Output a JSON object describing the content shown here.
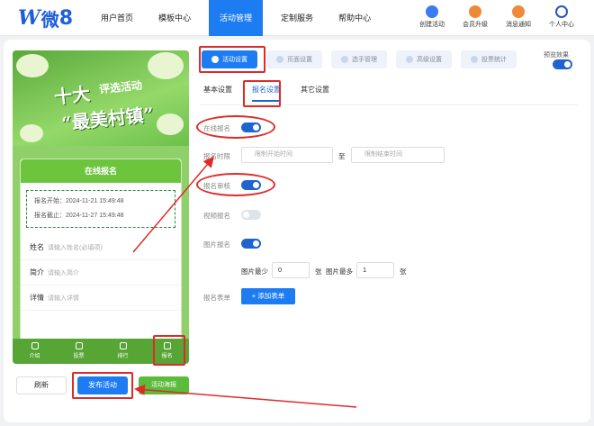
{
  "logo": {
    "w": "W",
    "wei": "微",
    "eight": "8"
  },
  "nav": [
    {
      "label": "用户首页"
    },
    {
      "label": "模板中心"
    },
    {
      "label": "活动管理"
    },
    {
      "label": "定制服务"
    },
    {
      "label": "帮助中心"
    }
  ],
  "tools": [
    {
      "label": "创建活动",
      "color": "#3a7cf0"
    },
    {
      "label": "会员升级",
      "color": "#f0883a"
    },
    {
      "label": "消息通知",
      "color": "#f0883a"
    },
    {
      "label": "个人中心",
      "color": "#2a55c0"
    }
  ],
  "phone": {
    "title_big1": "十大",
    "title_small": "评选活动",
    "title_big2": "“最美村镇”",
    "card_title": "在线报名",
    "start": "报名开始：2024-11-21 15:49:48",
    "end": "报名截止：2024-11-27 15:49:48",
    "fields": [
      {
        "label": "姓名",
        "ph": "请输入姓名(必填项)"
      },
      {
        "label": "简介",
        "ph": "请输入简介"
      },
      {
        "label": "详情",
        "ph": "请输入详情"
      }
    ],
    "tabs": [
      {
        "label": "介绍"
      },
      {
        "label": "投票"
      },
      {
        "label": "排行"
      },
      {
        "label": "报名"
      }
    ]
  },
  "buttons": {
    "refresh": "刷新",
    "publish": "发布活动",
    "poster": "活动海报"
  },
  "sub_tabs": [
    {
      "label": "活动设置"
    },
    {
      "label": "页面设置"
    },
    {
      "label": "选手管理"
    },
    {
      "label": "高级设置"
    },
    {
      "label": "投票统计"
    }
  ],
  "preview_label": "预览效果",
  "inner_tabs": [
    {
      "label": "基本设置"
    },
    {
      "label": "报名设置"
    },
    {
      "label": "其它设置"
    }
  ],
  "form": {
    "online": "在线报名",
    "time": "报名时限",
    "start_ph": "限制开始时间",
    "to": "至",
    "end_ph": "限制结束时间",
    "review": "报名审核",
    "video": "视频报名",
    "image": "图片报名",
    "min_label": "图片最少",
    "min_val": "0",
    "unit1": "张",
    "max_label": "图片最多",
    "max_val": "1",
    "unit2": "张",
    "formlbl": "报名表单",
    "add": "+ 添加表单"
  },
  "colors": {
    "accent": "#1e7cf2",
    "annotation": "#e02a2a"
  }
}
